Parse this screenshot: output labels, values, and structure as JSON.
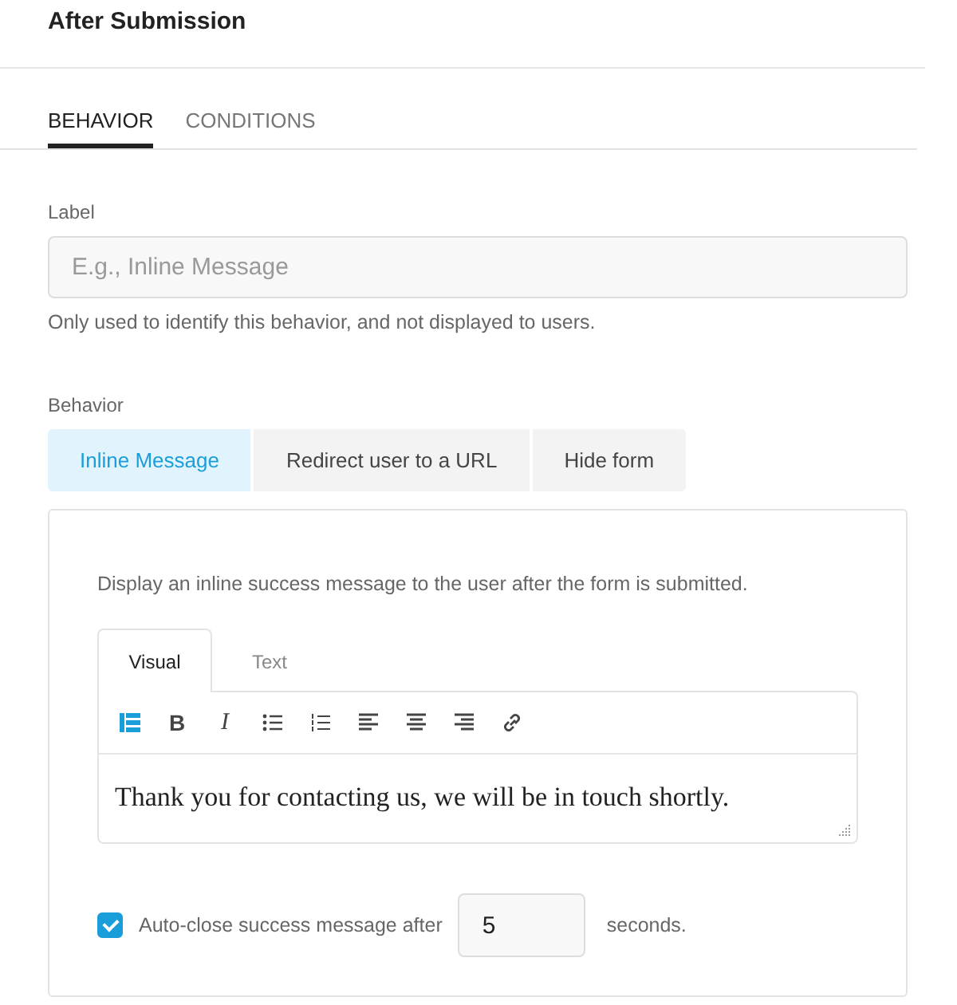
{
  "title": "After Submission",
  "tabs": [
    {
      "label": "BEHAVIOR",
      "selected": true
    },
    {
      "label": "CONDITIONS",
      "selected": false
    }
  ],
  "label_field": {
    "label": "Label",
    "placeholder": "E.g., Inline Message",
    "help": "Only used to identify this behavior, and not displayed to users."
  },
  "behavior": {
    "label": "Behavior",
    "options": [
      {
        "label": "Inline Message",
        "selected": true
      },
      {
        "label": "Redirect user to a URL",
        "selected": false
      },
      {
        "label": "Hide form",
        "selected": false
      }
    ]
  },
  "panel": {
    "description": "Display an inline success message to the user after the form is submitted.",
    "editor_tabs": [
      {
        "label": "Visual",
        "selected": true
      },
      {
        "label": "Text",
        "selected": false
      }
    ],
    "toolbar": [
      {
        "kind": "format",
        "active": true
      },
      {
        "kind": "bold",
        "glyph": "B",
        "active": false
      },
      {
        "kind": "italic",
        "glyph": "I",
        "active": false
      },
      {
        "kind": "bullet-list",
        "active": false
      },
      {
        "kind": "numbered-list",
        "active": false
      },
      {
        "kind": "align-left",
        "active": false
      },
      {
        "kind": "align-center",
        "active": false
      },
      {
        "kind": "align-right",
        "active": false
      },
      {
        "kind": "link",
        "active": false
      }
    ],
    "content": "Thank you for contacting us, we will be in touch shortly.",
    "auto_close": {
      "checked": true,
      "label": "Auto-close success message after",
      "value": "5",
      "suffix": "seconds."
    }
  }
}
